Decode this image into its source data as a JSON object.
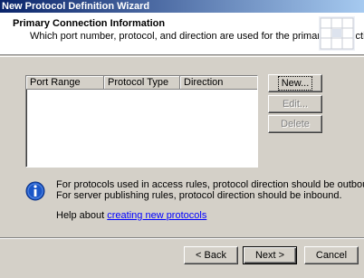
{
  "window": {
    "title": "New Protocol Definition Wizard"
  },
  "header": {
    "title": "Primary Connection Information",
    "subtitle": "Which port number, protocol, and direction are used for the primary connection?",
    "icon": "wizard-banner-icon"
  },
  "table": {
    "columns": [
      "Port Range",
      "Protocol Type",
      "Direction"
    ],
    "rows": []
  },
  "side_buttons": {
    "new": {
      "label": "New...",
      "enabled": true
    },
    "edit": {
      "label": "Edit...",
      "enabled": false
    },
    "delete": {
      "label": "Delete",
      "enabled": false
    }
  },
  "info": {
    "icon": "info-icon",
    "line1": "For protocols used in access rules, protocol direction should be outbound.",
    "line2": "For server publishing rules, protocol direction should be inbound."
  },
  "help": {
    "prefix": "Help about ",
    "link": "creating new protocols"
  },
  "nav_buttons": {
    "back": "< Back",
    "next": "Next >",
    "cancel": "Cancel"
  },
  "colors": {
    "dialog_bg": "#d4d0c8",
    "title_start": "#0a246a",
    "title_end": "#a6caf0",
    "link": "#0000ff",
    "info_blue": "#1a56c8"
  }
}
